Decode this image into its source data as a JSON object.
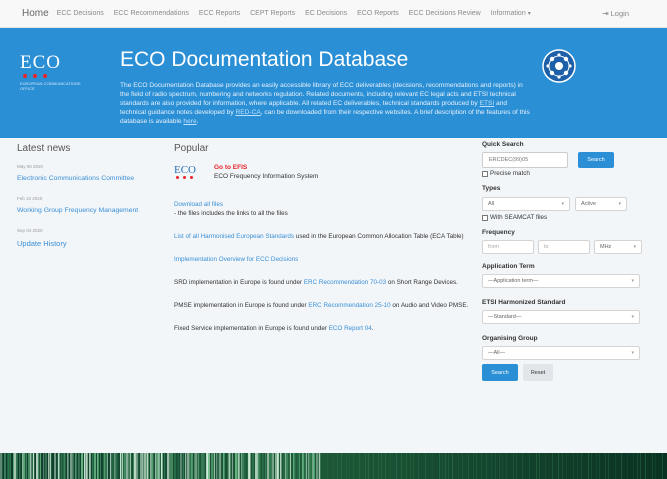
{
  "nav": {
    "home": "Home",
    "items": [
      "ECC Decisions",
      "ECC Recommendations",
      "ECC Reports",
      "CEPT Reports",
      "EC Decisions",
      "ECO Reports",
      "ECC Decisions Review",
      "Information"
    ],
    "login": "Login"
  },
  "hero": {
    "logo_text": "ECO",
    "logo_sub": "EUROPEAN COMMUNICATIONS OFFICE",
    "title": "ECO Documentation Database",
    "desc_p1": "The ECO Documentation Database provides an easily accessible library of ECC deliverables (decisions, recommendations and reports) in the field of radio spectrum, numbering and networks regulation. Related documents, including relevant EC legal acts and ETSI technical standards are also provided for information, where applicable. All related EC deliverables, technical standards produced by ",
    "desc_link1": "ETSI",
    "desc_p2": " and technical guidance notes developed by ",
    "desc_link2": "RED-CA",
    "desc_p3": ", can be downloaded from their respective websites. A brief description of the features of this database is available ",
    "desc_link3": "here",
    "desc_p4": "."
  },
  "latest_news": {
    "title": "Latest news",
    "items": [
      {
        "date": "May 08 2020",
        "text": "Electronic Communications Committee"
      },
      {
        "date": "Feb 10 2020",
        "text": "Working Group Frequency Management"
      },
      {
        "date": "Sep 04 2020",
        "text": "Update History"
      }
    ]
  },
  "popular": {
    "title": "Popular",
    "efis_logo": "ECO",
    "efis_link": "Go to EFIS",
    "efis_name": "ECO Frequency Information System",
    "download_link": "Download all files",
    "download_note": "- the files includes the links to all the files",
    "hes_link": "List of all Harmonised European Standards",
    "hes_text": " used in the European Common Allocation Table (ECA Table)",
    "impl_link": "Implementation Overview for ECC Decisions",
    "srd_text1": "SRD implementation in Europe is found under ",
    "srd_link": "ERC Recommendation 70-03",
    "srd_text2": " on Short Range Devices.",
    "pmse_text1": "PMSE implementation in Europe is found under ",
    "pmse_link": "ERC Recommendation 25-10",
    "pmse_text2": " on Audio and Video PMSE.",
    "fixed_text1": "Fixed Service implementation in Europe is found under ",
    "fixed_link": "ECO Report 04",
    "fixed_text2": "."
  },
  "search": {
    "quick_label": "Quick Search",
    "quick_placeholder": "ERCDEC(99)05",
    "search_button": "Search",
    "precise_label": "Precise match",
    "types_label": "Types",
    "types_value": "All",
    "status_value": "Active",
    "seamcat_label": "With SEAMCAT files",
    "freq_label": "Frequency",
    "freq_from": "from",
    "freq_to": "to",
    "freq_unit": "MHz",
    "app_label": "Application Term",
    "app_value": "—Application term—",
    "etsi_label": "ETSI Harmonized Standard",
    "etsi_value": "—Standard—",
    "org_label": "Organising Group",
    "org_value": "—All—",
    "search_btn2": "Search",
    "reset_btn": "Reset"
  },
  "colors": {
    "primary": "#2b8fd6",
    "accent_red": "#e8232a",
    "banner": "#0e3f2d"
  }
}
